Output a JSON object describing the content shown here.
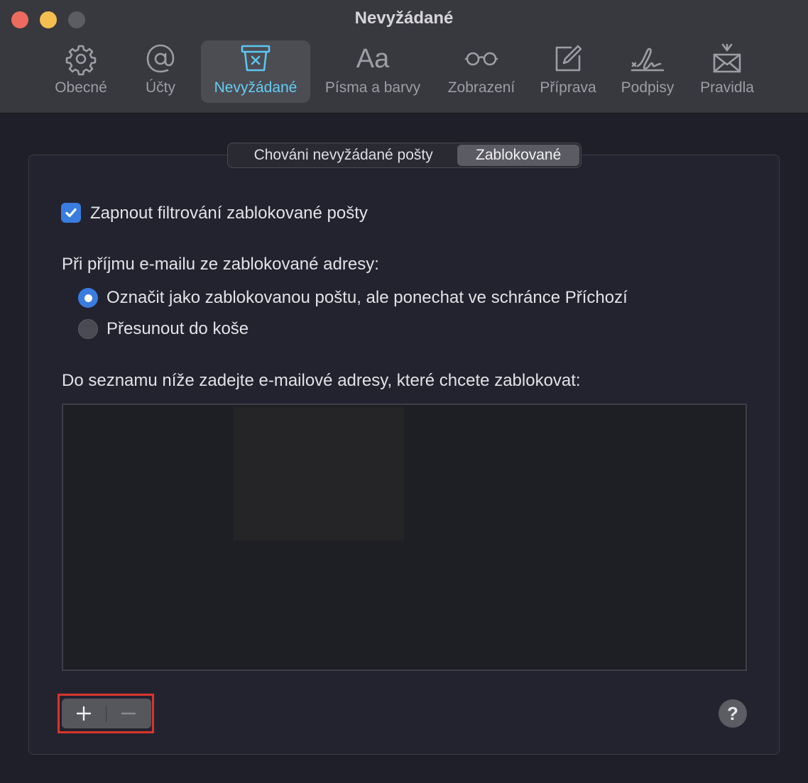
{
  "window": {
    "title": "Nevyžádané"
  },
  "toolbar": {
    "items": [
      {
        "label": "Obecné",
        "icon": "gear-icon"
      },
      {
        "label": "Účty",
        "icon": "at-sign-icon"
      },
      {
        "label": "Nevyžádané",
        "icon": "junk-bin-icon",
        "selected": true
      },
      {
        "label": "Písma a barvy",
        "icon": "font-aa-icon",
        "glyph": "Aa"
      },
      {
        "label": "Zobrazení",
        "icon": "glasses-icon"
      },
      {
        "label": "Příprava",
        "icon": "compose-icon"
      },
      {
        "label": "Podpisy",
        "icon": "signature-icon"
      },
      {
        "label": "Pravidla",
        "icon": "rules-envelope-icon"
      }
    ]
  },
  "tabs": [
    {
      "label": "Chováni nevyžádané pošty",
      "selected": false
    },
    {
      "label": "Zablokované",
      "selected": true
    }
  ],
  "blocked": {
    "enable_checkbox": {
      "label": "Zapnout filtrování zablokované pošty",
      "checked": true
    },
    "on_receive_label": "Při příjmu e-mailu ze zablokované adresy:",
    "radio_options": [
      {
        "label": "Označit jako zablokovanou poštu, ale ponechat ve schránce Příchozí",
        "selected": true
      },
      {
        "label": "Přesunout do koše",
        "selected": false
      }
    ],
    "list_label": "Do seznamu níže zadejte e-mailové adresy, které chcete zablokovat:",
    "addresses": []
  },
  "controls": {
    "add_symbol": "+",
    "remove_symbol": "−",
    "help_symbol": "?"
  },
  "colors": {
    "accent": "#3a7de0",
    "selected_tool": "#5ac6f0",
    "highlight": "#d8352a"
  }
}
